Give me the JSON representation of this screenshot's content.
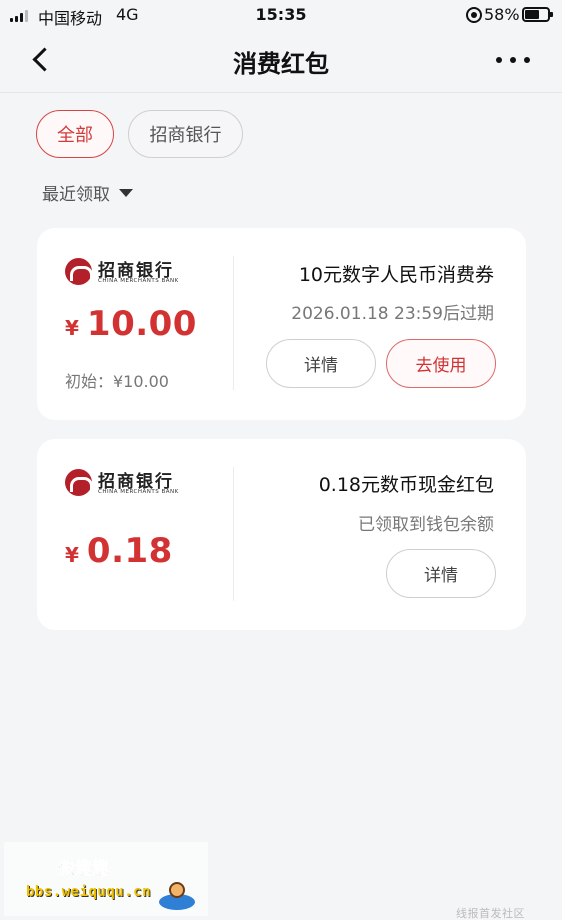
{
  "status_bar": {
    "carrier": "中国移动",
    "network": "4G",
    "time": "15:35",
    "battery_percent": "58%"
  },
  "header": {
    "title": "消费红包"
  },
  "filters": {
    "chips": [
      {
        "label": "全部",
        "selected": true
      },
      {
        "label": "招商银行",
        "selected": false
      }
    ],
    "sort_label": "最近领取"
  },
  "coupons": [
    {
      "bank_name": "招商银行",
      "bank_name_en": "CHINA MERCHANTS BANK",
      "currency": "¥",
      "amount": "10.00",
      "initial_label": "初始：¥10.00",
      "title": "10元数字人民币消费券",
      "subtitle": "2026.01.18 23:59后过期",
      "detail_label": "详情",
      "use_label": "去使用"
    },
    {
      "bank_name": "招商银行",
      "bank_name_en": "CHINA MERCHANTS BANK",
      "currency": "¥",
      "amount": "0.18",
      "title": "0.18元数币现金红包",
      "subtitle": "已领取到钱包余额",
      "detail_label": "详情"
    }
  ],
  "watermark": {
    "title": "微趣趣",
    "url": "bbs.weiququ.cn",
    "corner": "线报首发社区"
  },
  "colors": {
    "accent_red": "#d23232",
    "bank_red": "#b3202a",
    "background": "#f4f5f7"
  },
  "icons": [
    "signal-icon",
    "alarm-lock-icon",
    "battery-icon",
    "back-arrow-icon",
    "more-dots-icon",
    "caret-down-icon",
    "cmb-logo-icon"
  ]
}
